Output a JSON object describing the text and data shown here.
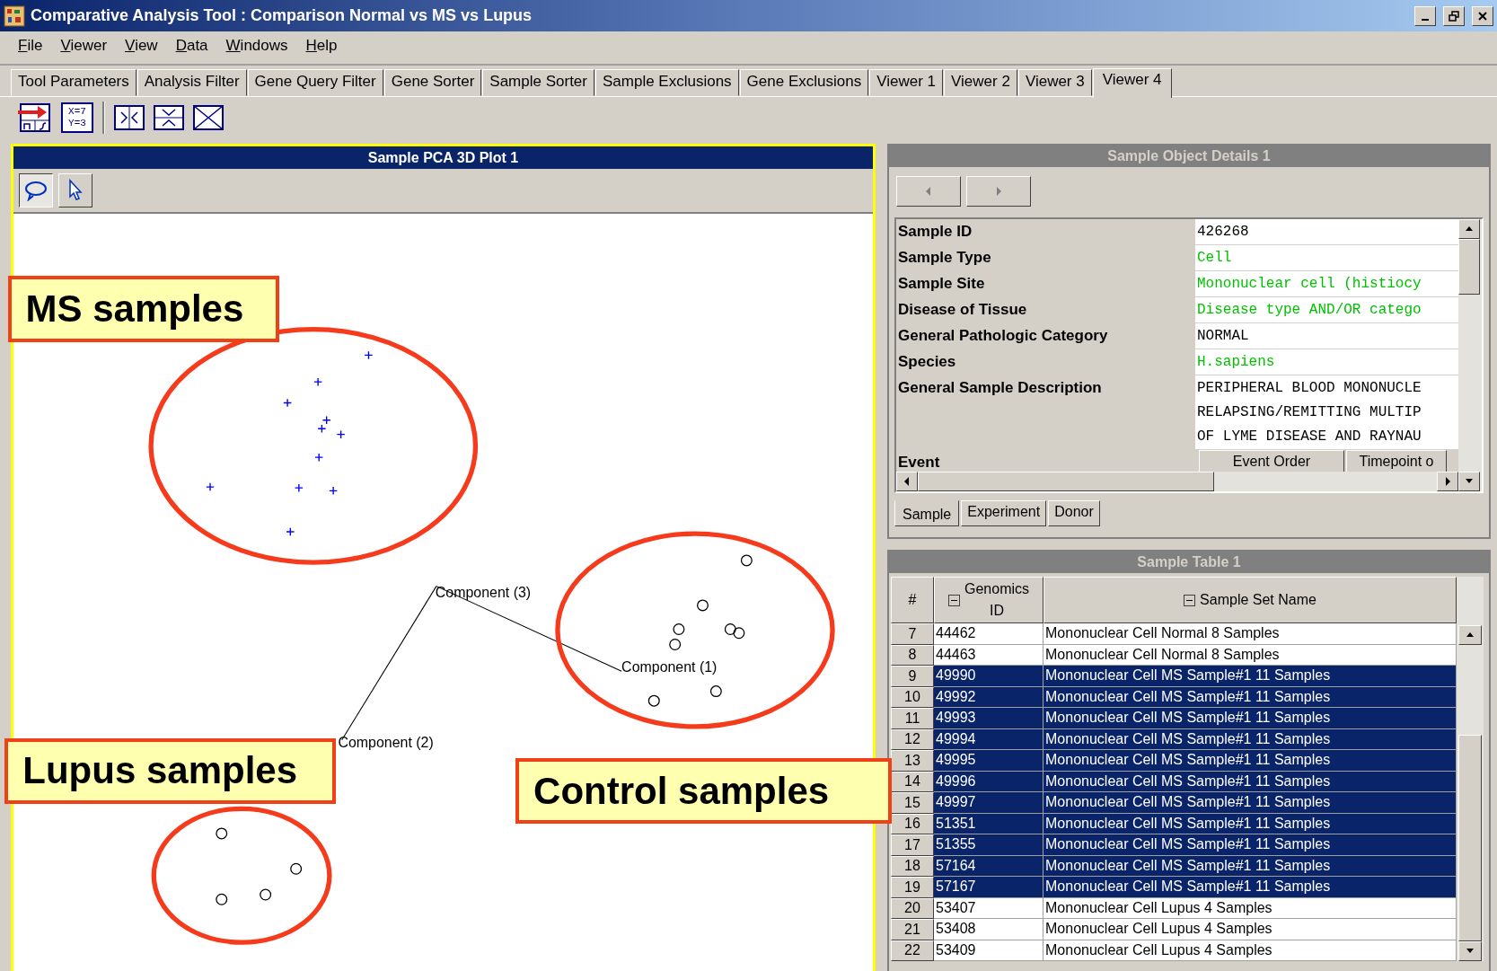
{
  "window": {
    "title": "Comparative Analysis Tool : Comparison Normal vs MS vs Lupus"
  },
  "menu": [
    "File",
    "Viewer",
    "View",
    "Data",
    "Windows",
    "Help"
  ],
  "tabs": [
    {
      "label": "Tool Parameters",
      "selected": false
    },
    {
      "label": "Analysis Filter",
      "selected": false
    },
    {
      "label": "Gene Query Filter",
      "selected": false
    },
    {
      "label": "Gene Sorter",
      "selected": false
    },
    {
      "label": "Sample Sorter",
      "selected": false
    },
    {
      "label": "Sample Exclusions",
      "selected": false
    },
    {
      "label": "Gene Exclusions",
      "selected": false
    },
    {
      "label": "Viewer 1",
      "selected": false
    },
    {
      "label": "Viewer 2",
      "selected": false
    },
    {
      "label": "Viewer 3",
      "selected": false
    },
    {
      "label": "Viewer 4",
      "selected": true
    }
  ],
  "toolbar": {
    "formula_label": "X=7\nY=3"
  },
  "plot": {
    "title": "Sample PCA 3D Plot 1",
    "tools": [
      {
        "kind": "lasso",
        "selected": true
      },
      {
        "kind": "pointer",
        "selected": false
      }
    ],
    "axes": [
      {
        "label": "Component (3)"
      },
      {
        "label": "Component (1)"
      },
      {
        "label": "Component (2)"
      }
    ],
    "callouts": [
      {
        "label": "MS samples"
      },
      {
        "label": "Lupus samples"
      },
      {
        "label": "Control samples"
      }
    ]
  },
  "details": {
    "title": "Sample Object Details 1",
    "properties": [
      {
        "label": "Sample ID",
        "kind": "value",
        "lines": [
          "426268"
        ],
        "color": "#000000"
      },
      {
        "label": "Sample Type",
        "kind": "value",
        "lines": [
          "Cell"
        ],
        "color": "#00c000"
      },
      {
        "label": "Sample Site",
        "kind": "value",
        "lines": [
          "Mononuclear cell (histiocy"
        ],
        "color": "#00c000"
      },
      {
        "label": "Disease of Tissue",
        "kind": "value",
        "lines": [
          "Disease type AND/OR catego"
        ],
        "color": "#00c000"
      },
      {
        "label": "General Pathologic Category",
        "kind": "value",
        "lines": [
          "NORMAL"
        ],
        "color": "#000000"
      },
      {
        "label": "Species",
        "kind": "value",
        "lines": [
          "H.sapiens"
        ],
        "color": "#00c000"
      },
      {
        "label": "General Sample Description",
        "kind": "value",
        "lines": [
          "PERIPHERAL BLOOD MONONUCLE",
          "RELAPSING/REMITTING MULTIP",
          "OF LYME DISEASE AND RAYNAU"
        ],
        "color": "#000000"
      },
      {
        "label": "Event",
        "kind": "subtable",
        "headers": [
          "Event Order",
          "Timepoint o"
        ]
      }
    ],
    "tabs": [
      {
        "label": "Sample",
        "selected": true
      },
      {
        "label": "Experiment",
        "selected": false
      },
      {
        "label": "Donor",
        "selected": false
      }
    ]
  },
  "table": {
    "title": "Sample Table 1",
    "columns": [
      "#",
      "Genomics\nID",
      "Sample Set Name"
    ],
    "rows": [
      {
        "n": "7",
        "id": "44462",
        "name": "Mononuclear Cell Normal 8 Samples",
        "selected": false
      },
      {
        "n": "8",
        "id": "44463",
        "name": "Mononuclear Cell Normal 8 Samples",
        "selected": false
      },
      {
        "n": "9",
        "id": "49990",
        "name": "Mononuclear Cell MS Sample#1 11 Samples",
        "selected": true
      },
      {
        "n": "10",
        "id": "49992",
        "name": "Mononuclear Cell MS Sample#1 11 Samples",
        "selected": true
      },
      {
        "n": "11",
        "id": "49993",
        "name": "Mononuclear Cell MS Sample#1 11 Samples",
        "selected": true
      },
      {
        "n": "12",
        "id": "49994",
        "name": "Mononuclear Cell MS Sample#1 11 Samples",
        "selected": true
      },
      {
        "n": "13",
        "id": "49995",
        "name": "Mononuclear Cell MS Sample#1 11 Samples",
        "selected": true
      },
      {
        "n": "14",
        "id": "49996",
        "name": "Mononuclear Cell MS Sample#1 11 Samples",
        "selected": true
      },
      {
        "n": "15",
        "id": "49997",
        "name": "Mononuclear Cell MS Sample#1 11 Samples",
        "selected": true
      },
      {
        "n": "16",
        "id": "51351",
        "name": "Mononuclear Cell MS Sample#1 11 Samples",
        "selected": true
      },
      {
        "n": "17",
        "id": "51355",
        "name": "Mononuclear Cell MS Sample#1 11 Samples",
        "selected": true
      },
      {
        "n": "18",
        "id": "57164",
        "name": "Mononuclear Cell MS Sample#1 11 Samples",
        "selected": true
      },
      {
        "n": "19",
        "id": "57167",
        "name": "Mononuclear Cell MS Sample#1 11 Samples",
        "selected": true
      },
      {
        "n": "20",
        "id": "53407",
        "name": "Mononuclear Cell Lupus 4 Samples",
        "selected": false
      },
      {
        "n": "21",
        "id": "53408",
        "name": "Mononuclear Cell Lupus 4 Samples",
        "selected": false
      },
      {
        "n": "22",
        "id": "53409",
        "name": "Mononuclear Cell Lupus 4 Samples",
        "selected": false
      }
    ]
  }
}
